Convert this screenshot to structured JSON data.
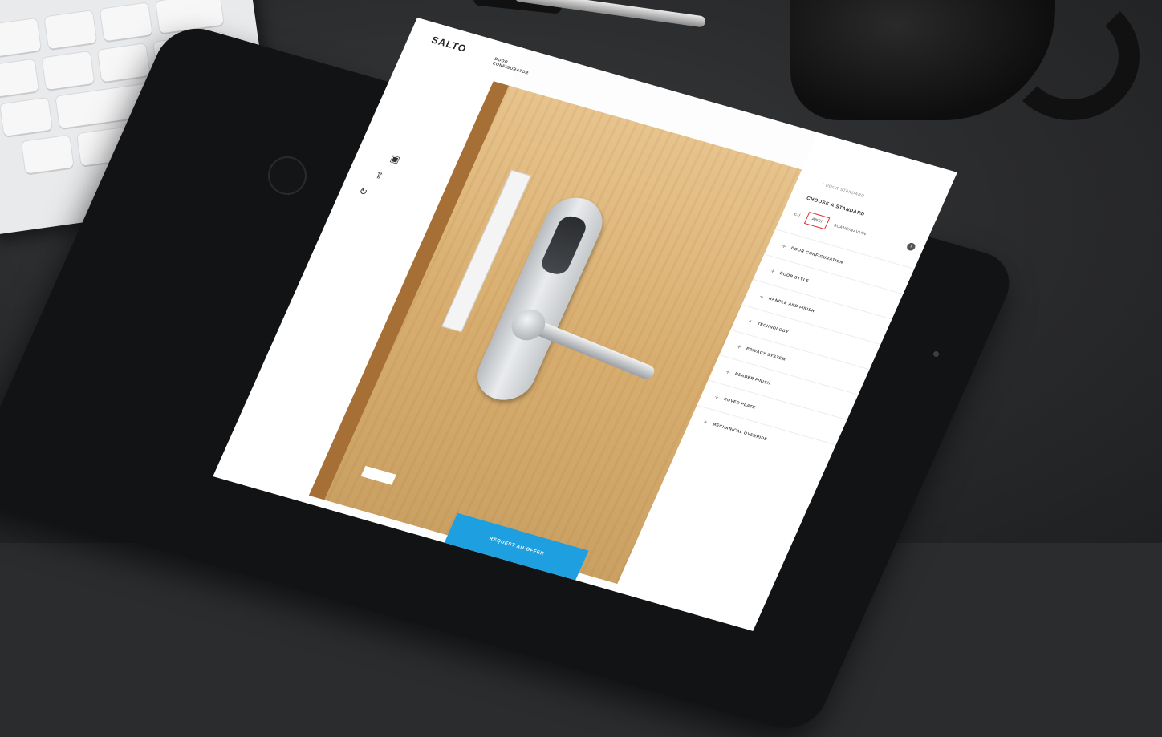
{
  "brand": {
    "logo_text": "SALTO"
  },
  "nav": {
    "active_link": "DOOR CONFIGURATOR"
  },
  "left_tools": {
    "icons": [
      "save-icon",
      "share-icon",
      "refresh-icon"
    ]
  },
  "door": {
    "badge": ""
  },
  "panel": {
    "back_link": "< DOOR STANDARD",
    "choose_label": "CHOOSE A STANDARD",
    "options": [
      "EU",
      "ANSI",
      "SCANDINAVIAN"
    ],
    "selected_option": "ANSI",
    "info_icon": "info-icon",
    "menu_items": [
      "DOOR CONFIGURATION",
      "DOOR STYLE",
      "HANDLE AND FINISH",
      "TECHNOLOGY",
      "PRIVACY SYSTEM",
      "READER FINISH",
      "COVER PLATE",
      "MECHANICAL OVERRIDE"
    ]
  },
  "cta": {
    "label": "REQUEST AN OFFER"
  },
  "colors": {
    "accent": "#1e9fe0",
    "door_wood": "#d8ae70",
    "tablet": "#121314",
    "selected_border": "#dd3333"
  }
}
